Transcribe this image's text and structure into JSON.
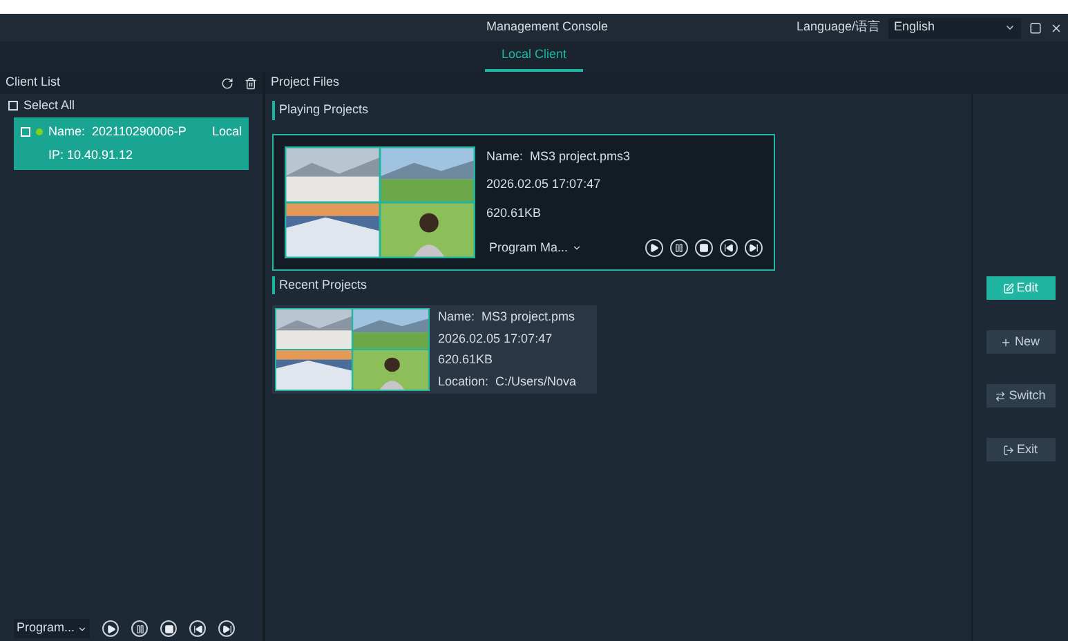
{
  "window": {
    "title": "Management Console",
    "language_label": "Language/语言",
    "language": "English"
  },
  "tabs": [
    {
      "label": "Local Client",
      "selected": true
    }
  ],
  "client_list": {
    "title": "Client List",
    "select_all": {
      "label": "Select All",
      "checked": false
    },
    "clients": [
      {
        "name": "Name:  202110290006-P",
        "ip": "IP: 10.40.91.12",
        "tag": "Local",
        "checked": false,
        "selected": true,
        "online": true
      }
    ],
    "program": "Program..."
  },
  "project_files": {
    "title": "Project Files",
    "playing": {
      "title": "Playing Projects",
      "name": "Name:  MS3 project.pms3",
      "date": "2026.02.05 17:07:47",
      "size": "620.61KB",
      "program": "Program Ma..."
    },
    "recent": {
      "title": "Recent Projects",
      "items": [
        {
          "name": "Name:  MS3 project.pms",
          "date": "2026.02.05 17:07:47",
          "size": "620.61KB",
          "location": "Location:  C:/Users/Nova"
        }
      ]
    }
  },
  "actions": [
    {
      "kind": "edit",
      "label": "Edit",
      "primary": true
    },
    {
      "kind": "new",
      "label": "New",
      "primary": false
    },
    {
      "kind": "switch",
      "label": "Switch",
      "primary": false
    },
    {
      "kind": "exit",
      "label": "Exit",
      "primary": false
    }
  ]
}
